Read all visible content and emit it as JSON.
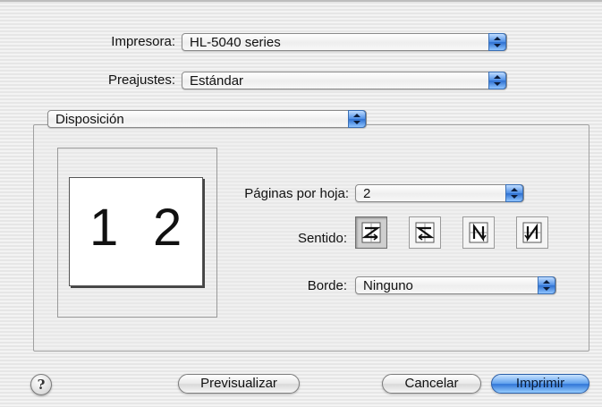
{
  "printer": {
    "label": "Impresora:",
    "value": "HL-5040 series"
  },
  "presets": {
    "label": "Preajustes:",
    "value": "Estándar"
  },
  "panel": {
    "value": "Disposición"
  },
  "preview": {
    "left_num": "1",
    "right_num": "2"
  },
  "pages_per_sheet": {
    "label": "Páginas por hoja:",
    "value": "2"
  },
  "orientation": {
    "label": "Sentido:",
    "options": [
      {
        "name": "orientation-z-icon",
        "selected": true
      },
      {
        "name": "orientation-s-icon",
        "selected": false
      },
      {
        "name": "orientation-n-reverse-icon",
        "selected": false
      },
      {
        "name": "orientation-n-icon",
        "selected": false
      }
    ]
  },
  "border": {
    "label": "Borde:",
    "value": "Ninguno"
  },
  "buttons": {
    "help": "?",
    "preview": "Previsualizar",
    "cancel": "Cancelar",
    "print": "Imprimir"
  },
  "colors": {
    "accent": "#2f74d6",
    "selected_button": "#cfcfcf"
  }
}
